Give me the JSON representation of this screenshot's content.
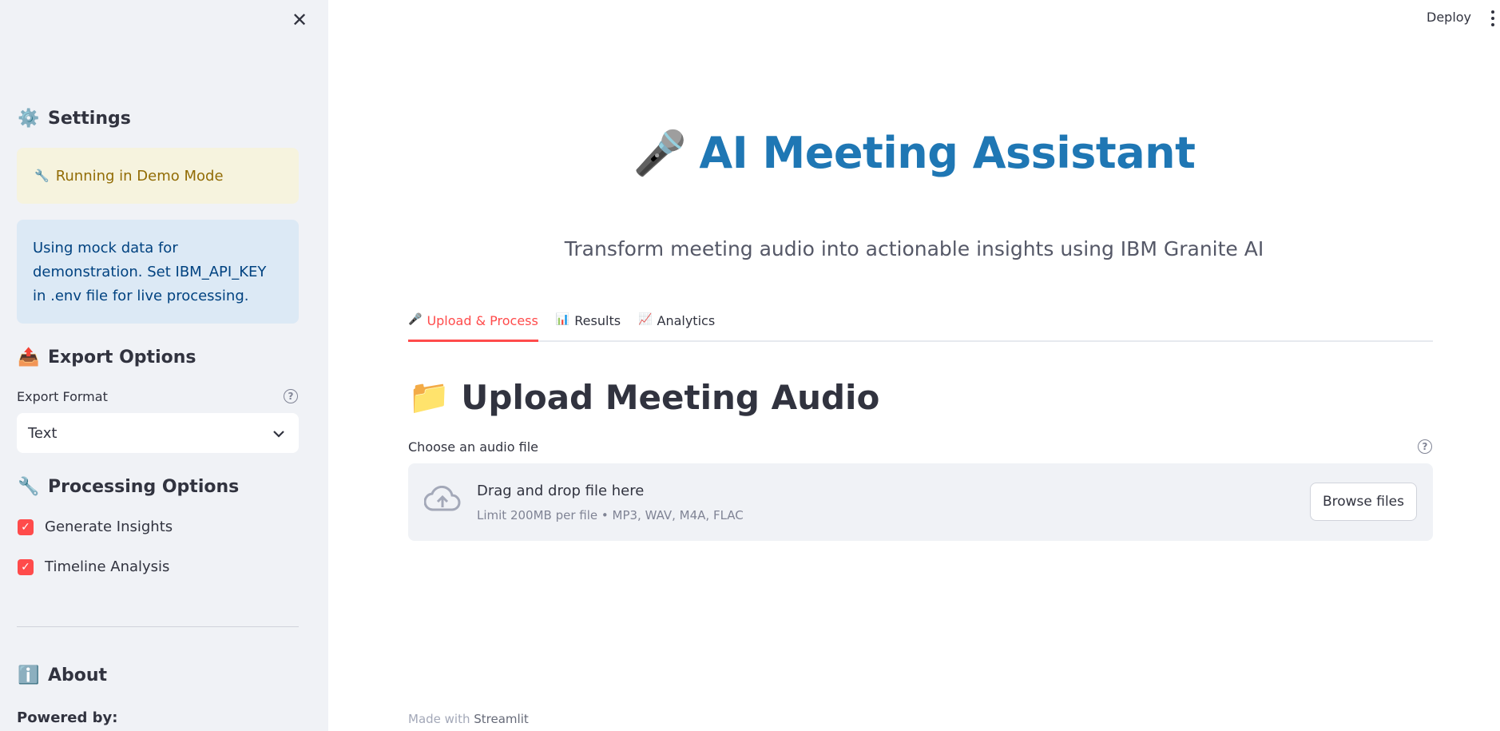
{
  "sidebar": {
    "close_glyph": "✕",
    "settings": {
      "emoji": "⚙️",
      "title": "Settings"
    },
    "demo_warning": {
      "emoji": "🔧",
      "text": "Running in Demo Mode"
    },
    "info_text": "Using mock data for demonstration. Set IBM_API_KEY in .env file for live processing.",
    "export": {
      "emoji": "📤",
      "title": "Export Options",
      "format_label": "Export Format",
      "format_value": "Text"
    },
    "processing": {
      "emoji": "🔧",
      "title": "Processing Options",
      "options": [
        {
          "label": "Generate Insights",
          "checked": true
        },
        {
          "label": "Timeline Analysis",
          "checked": true
        }
      ]
    },
    "about": {
      "emoji": "ℹ️",
      "title": "About"
    },
    "powered_by": "Powered by:"
  },
  "header": {
    "deploy_label": "Deploy"
  },
  "main": {
    "title_emoji": "🎤",
    "title": "AI Meeting Assistant",
    "subtitle": "Transform meeting audio into actionable insights using IBM Granite AI",
    "tabs": [
      {
        "emoji": "🎤",
        "label": "Upload & Process",
        "active": true
      },
      {
        "emoji": "📊",
        "label": "Results",
        "active": false
      },
      {
        "emoji": "📈",
        "label": "Analytics",
        "active": false
      }
    ],
    "section": {
      "emoji": "📁",
      "title": "Upload Meeting Audio"
    },
    "uploader": {
      "label": "Choose an audio file",
      "drop_text": "Drag and drop file here",
      "limit_text": "Limit 200MB per file • MP3, WAV, M4A, FLAC",
      "browse_label": "Browse files"
    }
  },
  "footer": {
    "made_with": "Made with",
    "brand": "Streamlit"
  },
  "colors": {
    "accent": "#ff4b4b",
    "title_blue": "#1f77b4",
    "sidebar_bg": "#f0f2f6"
  }
}
